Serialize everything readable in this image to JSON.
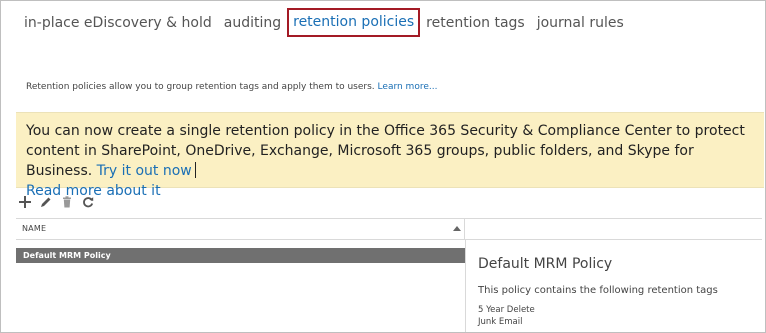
{
  "tabs": [
    {
      "label": "in-place eDiscovery & hold",
      "active": false
    },
    {
      "label": "auditing",
      "active": false
    },
    {
      "label": "retention policies",
      "active": true
    },
    {
      "label": "retention tags",
      "active": false
    },
    {
      "label": "journal rules",
      "active": false
    }
  ],
  "description": {
    "text": "Retention policies allow you to group retention tags and apply them to users.",
    "link": "Learn more..."
  },
  "banner": {
    "text": "You can now create a single retention policy in the Office 365 Security & Compliance Center to protect content in SharePoint, OneDrive, Exchange, Microsoft 365 groups, public folders, and Skype for Business.",
    "try_link": "Try it out now",
    "read_more_link": "Read more about it"
  },
  "toolbar": {
    "icons": [
      "add-icon",
      "edit-icon",
      "delete-icon",
      "refresh-icon"
    ]
  },
  "table": {
    "column_name": "NAME",
    "rows": [
      {
        "name": "Default MRM Policy",
        "selected": true
      }
    ]
  },
  "details": {
    "title": "Default MRM Policy",
    "subtitle": "This policy contains the following retention tags",
    "tags": [
      "5 Year Delete",
      "Junk Email"
    ]
  },
  "colors": {
    "link": "#1a6fb5",
    "active_tab_border": "#a31a25",
    "banner_bg": "#fbf0c3",
    "selected_row_bg": "#707070"
  }
}
